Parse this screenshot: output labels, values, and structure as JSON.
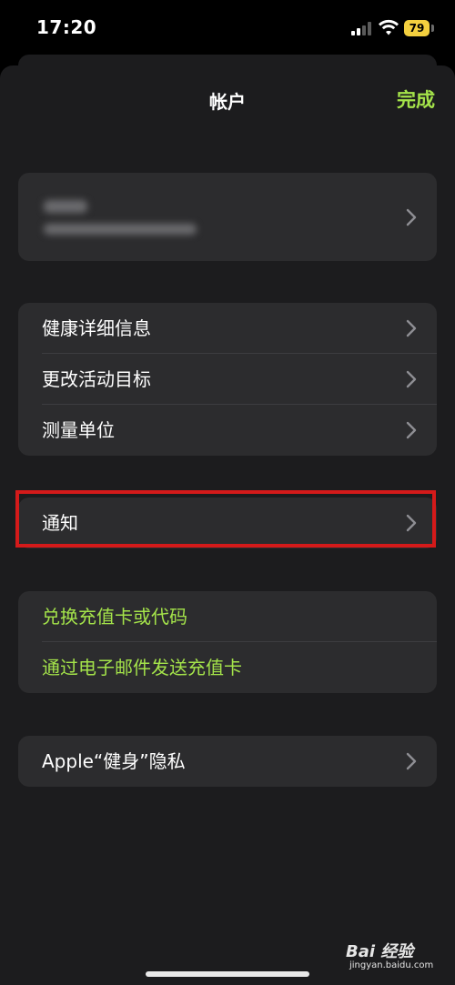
{
  "status_bar": {
    "time": "17:20",
    "battery_level": "79",
    "battery_color": "#f4d03f"
  },
  "nav": {
    "title": "帐户",
    "done_label": "完成",
    "accent_color": "#a4e34a"
  },
  "account_group": {
    "chevron_icon": "chevron-right-icon"
  },
  "health_group": {
    "items": [
      {
        "label": "健康详细信息"
      },
      {
        "label": "更改活动目标"
      },
      {
        "label": "测量单位"
      }
    ]
  },
  "notifications_group": {
    "items": [
      {
        "label": "通知"
      }
    ]
  },
  "gift_group": {
    "items": [
      {
        "label": "兑换充值卡或代码"
      },
      {
        "label": "通过电子邮件发送充值卡"
      }
    ]
  },
  "privacy_group": {
    "items": [
      {
        "label": "Apple“健身”隐私"
      }
    ]
  },
  "highlight_color": "#d41a1a",
  "watermark": {
    "brand": "Bai 经验",
    "url": "jingyan.baidu.com"
  }
}
